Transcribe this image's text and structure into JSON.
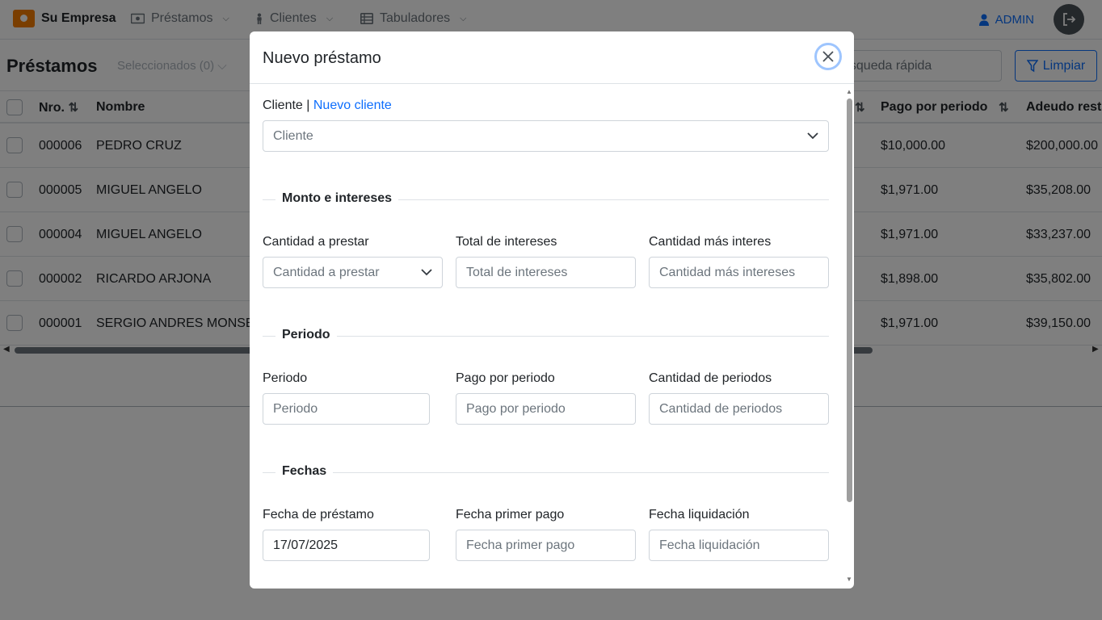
{
  "app": {
    "brand": "Su Empresa",
    "nav": [
      {
        "label": "Préstamos",
        "icon": "money-icon"
      },
      {
        "label": "Clientes",
        "icon": "person-icon"
      },
      {
        "label": "Tabuladores",
        "icon": "table-icon"
      }
    ],
    "user": "ADMIN"
  },
  "page": {
    "title": "Préstamos",
    "selected": "Seleccionados (0)",
    "search_placeholder": "Búsqueda rápida",
    "search_visible_text": "úsqueda rápida",
    "clear_label": "Limpiar"
  },
  "table": {
    "headers": {
      "nro": "Nro.",
      "nombre": "Nombre",
      "pago": "Pago por periodo",
      "adeudo": "Adeudo resta"
    },
    "rows": [
      {
        "nro": "000006",
        "nombre": "PEDRO CRUZ",
        "pago": "$10,000.00",
        "adeudo": "$200,000.00"
      },
      {
        "nro": "000005",
        "nombre": "MIGUEL ANGELO",
        "pago": "$1,971.00",
        "adeudo": "$35,208.00"
      },
      {
        "nro": "000004",
        "nombre": "MIGUEL ANGELO",
        "pago": "$1,971.00",
        "adeudo": "$33,237.00"
      },
      {
        "nro": "000002",
        "nombre": "RICARDO ARJONA",
        "pago": "$1,898.00",
        "adeudo": "$35,802.00"
      },
      {
        "nro": "000001",
        "nombre": "SERGIO ANDRES MONSERR",
        "pago": "$1,971.00",
        "adeudo": "$39,150.00"
      }
    ]
  },
  "modal": {
    "title": "Nuevo préstamo",
    "cliente_label": "Cliente",
    "separator": "|",
    "nuevo_cliente": "Nuevo cliente",
    "cliente_placeholder": "Cliente",
    "sections": {
      "monto": "Monto e intereses",
      "periodo": "Periodo",
      "fechas": "Fechas"
    },
    "fields": {
      "cantidad_label": "Cantidad a prestar",
      "cantidad_placeholder": "Cantidad a prestar",
      "intereses_label": "Total de intereses",
      "intereses_placeholder": "Total de intereses",
      "mas_interes_label": "Cantidad más interes",
      "mas_interes_placeholder": "Cantidad más intereses",
      "periodo_label": "Periodo",
      "periodo_placeholder": "Periodo",
      "pago_label": "Pago por periodo",
      "pago_placeholder": "Pago por periodo",
      "cant_periodos_label": "Cantidad de periodos",
      "cant_periodos_placeholder": "Cantidad de periodos",
      "fecha_prestamo_label": "Fecha de préstamo",
      "fecha_prestamo_value": "17/07/2025",
      "fecha_primer_label": "Fecha primer pago",
      "fecha_primer_placeholder": "Fecha primer pago",
      "fecha_liq_label": "Fecha liquidación",
      "fecha_liq_placeholder": "Fecha liquidación"
    }
  }
}
